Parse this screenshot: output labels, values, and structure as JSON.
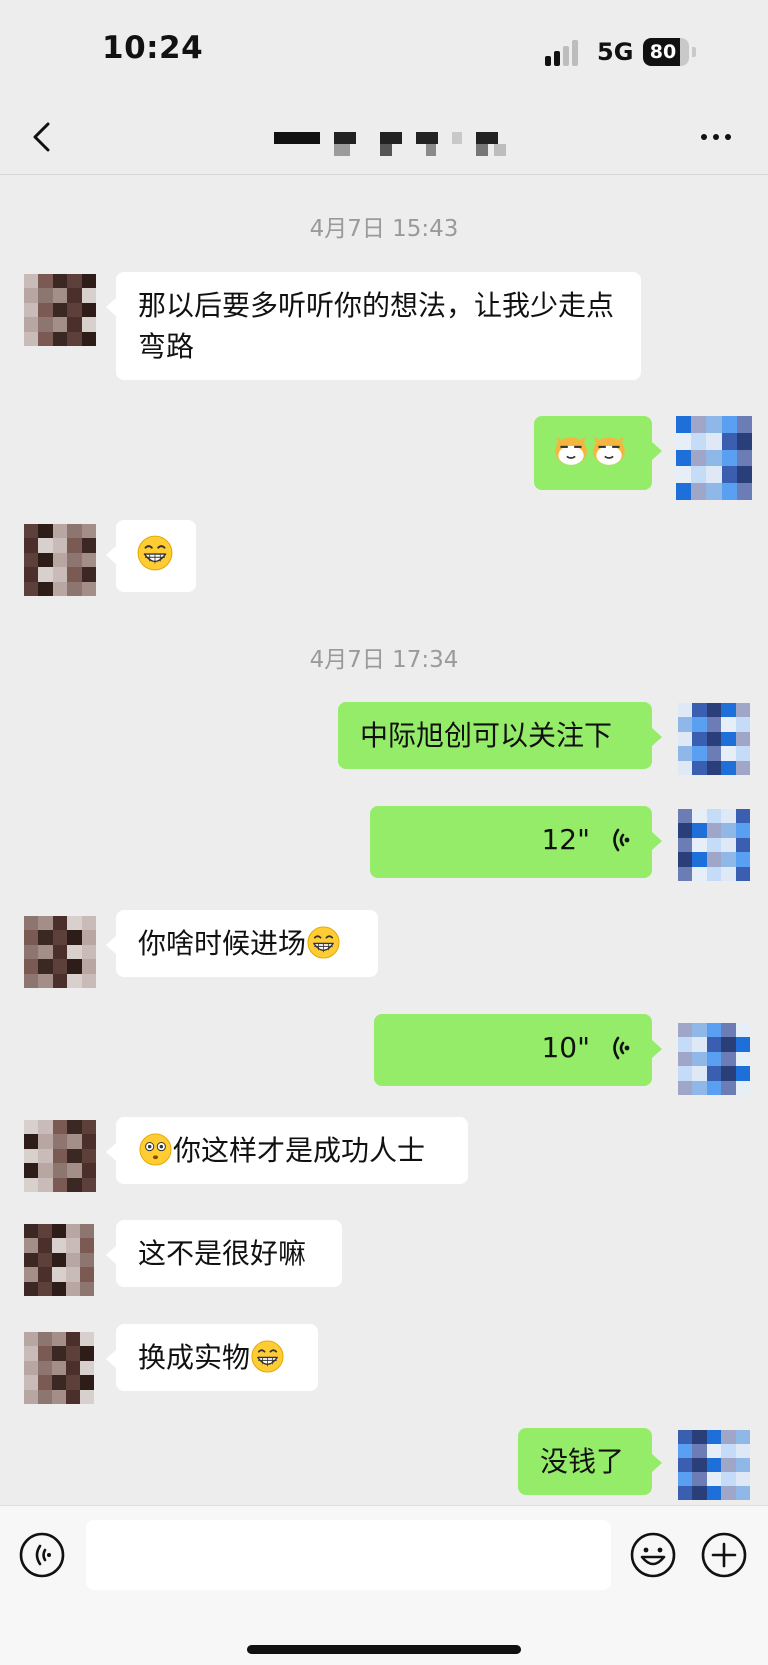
{
  "status_bar": {
    "time": "10:24",
    "network": "5G",
    "battery_level": "80",
    "battery_fraction": 0.8
  },
  "nav": {
    "back_icon": "chevron-left-icon",
    "more_icon": "more-dots-icon",
    "title_obscured": true
  },
  "messages": [
    {
      "type": "timestamp",
      "text": "4月7日 15:43"
    },
    {
      "type": "text",
      "dir": "in",
      "text": "那以后要多听听你的想法，让我少走点弯路"
    },
    {
      "type": "emoji",
      "dir": "out",
      "icons": [
        "cat-emoji",
        "cat-emoji"
      ]
    },
    {
      "type": "emoji",
      "dir": "in",
      "icons": [
        "grin-emoji"
      ]
    },
    {
      "type": "timestamp",
      "text": "4月7日 17:34"
    },
    {
      "type": "text",
      "dir": "out",
      "text": "中际旭创可以关注下"
    },
    {
      "type": "voice",
      "dir": "out",
      "duration": "12\""
    },
    {
      "type": "text",
      "dir": "in",
      "text": "你啥时候进场",
      "trailing_emoji": "grin-emoji"
    },
    {
      "type": "voice",
      "dir": "out",
      "duration": "10\""
    },
    {
      "type": "text",
      "dir": "in",
      "text": "你这样才是成功人士",
      "leading_emoji": "flushed-emoji"
    },
    {
      "type": "text",
      "dir": "in",
      "text": "这不是很好嘛"
    },
    {
      "type": "text",
      "dir": "in",
      "text": "换成实物",
      "trailing_emoji": "grin-emoji"
    },
    {
      "type": "text",
      "dir": "out",
      "text": "没钱了"
    }
  ],
  "input_bar": {
    "voice_icon": "voice-input-icon",
    "emoji_icon": "smiley-icon",
    "plus_icon": "plus-circle-icon",
    "input_value": ""
  },
  "colors": {
    "background": "#ededed",
    "bubble_out": "#95ec69",
    "bubble_in": "#ffffff",
    "timestamp": "#9a9a9a"
  }
}
